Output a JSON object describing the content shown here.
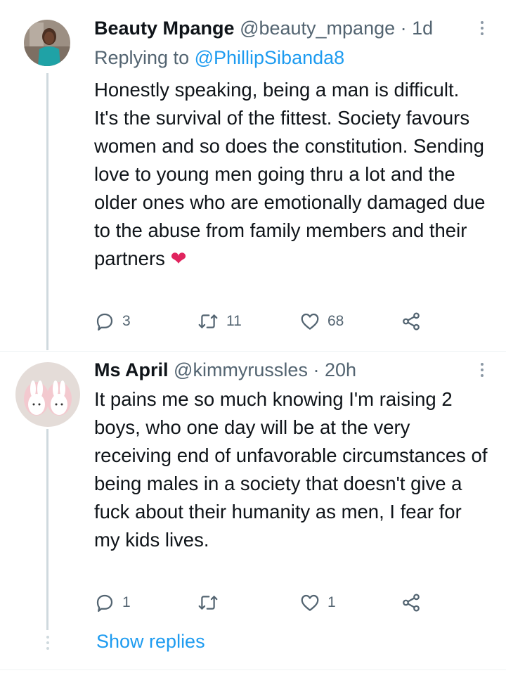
{
  "tweets": [
    {
      "name": "Beauty Mpange",
      "handle": "@beauty_mpange",
      "separator": "·",
      "time": "1d",
      "replying_prefix": "Replying to",
      "replying_handle": "@PhillipSibanda8",
      "text": "Honestly speaking, being a man is difficult. It's the survival of the fittest. Society favours women and so does the constitution. Sending love to young men going thru a lot and the older ones who are emotionally damaged due to the abuse from family members and their partners",
      "emoji": "❤",
      "replies": "3",
      "retweets": "11",
      "likes": "68"
    },
    {
      "name": "Ms April",
      "handle": "@kimmyrussles",
      "separator": "·",
      "time": "20h",
      "text": "It pains me so much knowing I'm raising 2 boys,  who one day will be at the very receiving end of unfavorable circumstances of being  males in a society that doesn't give a fuck about their humanity as men, I fear for my kids lives.",
      "replies": "1",
      "retweets": "",
      "likes": "1"
    }
  ],
  "show_replies": "Show replies",
  "colors": {
    "accent": "#1d9bf0",
    "secondary_text": "#536471",
    "heart": "#e0245e",
    "thread_line": "#cfd9de"
  },
  "icons": [
    "reply-icon",
    "retweet-icon",
    "like-icon",
    "share-icon",
    "more-icon"
  ]
}
